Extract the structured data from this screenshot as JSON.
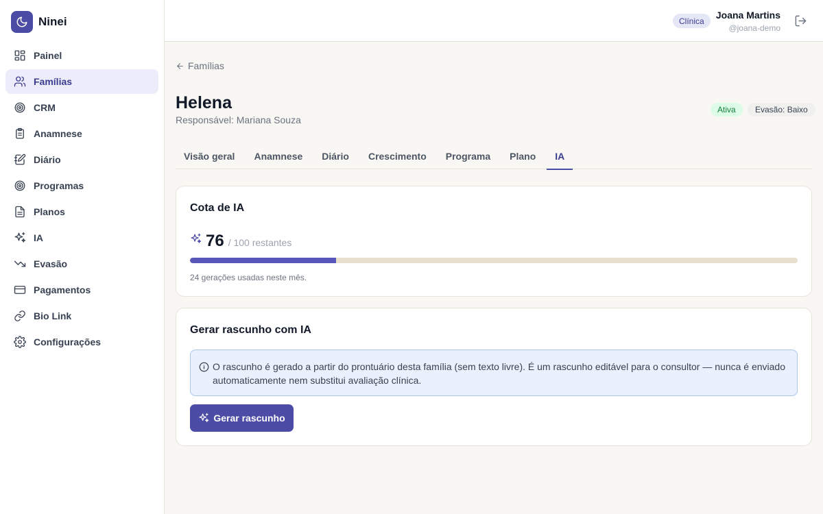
{
  "brand": {
    "name": "Ninei",
    "icon": "moon-icon"
  },
  "sidebar": {
    "items": [
      {
        "label": "Painel",
        "icon": "grid-icon"
      },
      {
        "label": "Famílias",
        "icon": "users-icon",
        "active": true
      },
      {
        "label": "CRM",
        "icon": "target-icon"
      },
      {
        "label": "Anamnese",
        "icon": "clipboard-icon"
      },
      {
        "label": "Diário",
        "icon": "notebook-icon"
      },
      {
        "label": "Programas",
        "icon": "target-icon"
      },
      {
        "label": "Planos",
        "icon": "file-icon"
      },
      {
        "label": "IA",
        "icon": "sparkles-icon"
      },
      {
        "label": "Evasão",
        "icon": "trending-down-icon"
      },
      {
        "label": "Pagamentos",
        "icon": "credit-card-icon"
      },
      {
        "label": "Bio Link",
        "icon": "link-icon"
      },
      {
        "label": "Configurações",
        "icon": "gear-icon"
      }
    ]
  },
  "header": {
    "role_badge": "Clínica",
    "user_name": "Joana Martins",
    "user_handle": "@joana-demo",
    "logout_icon": "logout-icon"
  },
  "page": {
    "back_label": "Famílias",
    "title": "Helena",
    "subtitle": "Responsável: Mariana Souza",
    "status_badge": "Ativa",
    "evasion_badge": "Evasão: Baixo",
    "tabs": [
      {
        "label": "Visão geral"
      },
      {
        "label": "Anamnese"
      },
      {
        "label": "Diário"
      },
      {
        "label": "Crescimento"
      },
      {
        "label": "Programa"
      },
      {
        "label": "Plano"
      },
      {
        "label": "IA",
        "active": true
      }
    ]
  },
  "quota": {
    "title": "Cota de IA",
    "remaining": "76",
    "total_label": "/ 100 restantes",
    "used_fraction": 0.24,
    "note": "24 gerações usadas neste mês."
  },
  "draft": {
    "title": "Gerar rascunho com IA",
    "info": "O rascunho é gerado a partir do prontuário desta família (sem texto livre). É um rascunho editável para o consultor — nunca é enviado automaticamente nem substitui avaliação clínica.",
    "button_label": "Gerar rascunho"
  },
  "colors": {
    "accent": "#4c4ba6",
    "active_badge_bg": "#dcfce7",
    "active_badge_text": "#15803d",
    "progress_track": "#e8e0cc"
  }
}
